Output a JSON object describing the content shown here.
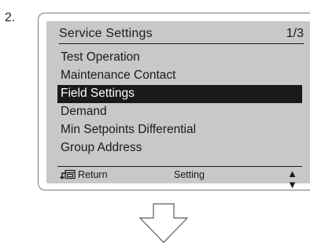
{
  "step": {
    "number": "2."
  },
  "screen": {
    "title": "Service Settings",
    "page": "1/3",
    "menu": [
      {
        "label": "Test Operation"
      },
      {
        "label": "Maintenance Contact"
      },
      {
        "label": "Field Settings"
      },
      {
        "label": "Demand"
      },
      {
        "label": "Min Setpoints Differential"
      },
      {
        "label": "Group Address"
      }
    ],
    "selected_index": 2,
    "footer": {
      "return_label": "Return",
      "setting_label": "Setting",
      "scroll_icon": "up-down-arrows-icon"
    }
  },
  "icons": {
    "return": "return-icon",
    "next_step": "down-arrow-icon"
  },
  "colors": {
    "screen_background": "#c8c8c8",
    "selection_background": "#1a1a1a",
    "selection_text": "#ffffff",
    "text": "#1a1a1a"
  }
}
